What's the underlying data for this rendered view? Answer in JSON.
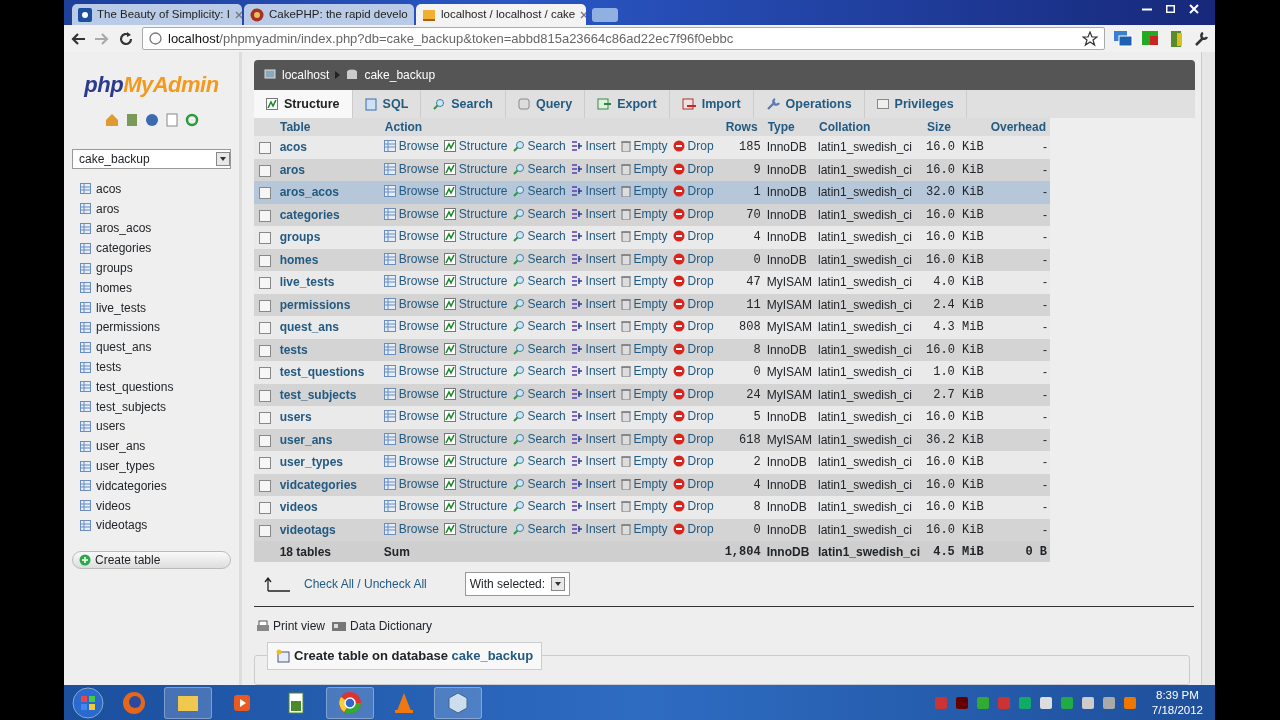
{
  "browser": {
    "tabs": [
      {
        "title": "The Beauty of Simplicity: I",
        "selected": false
      },
      {
        "title": "CakePHP: the rapid develo",
        "selected": false
      },
      {
        "title": "localhost / localhost / cake",
        "selected": true
      }
    ],
    "url_host": "localhost",
    "url_path": "/phpmyadmin/index.php?db=cake_backup&token=abbd815a23664c86ad22ec7f96f0ebbc"
  },
  "sidebar": {
    "logo": [
      "php",
      "MyAdmin"
    ],
    "database": "cake_backup",
    "tables": [
      "acos",
      "aros",
      "aros_acos",
      "categories",
      "groups",
      "homes",
      "live_tests",
      "permissions",
      "quest_ans",
      "tests",
      "test_questions",
      "test_subjects",
      "users",
      "user_ans",
      "user_types",
      "vidcategories",
      "videos",
      "videotags"
    ],
    "create_table": "Create table"
  },
  "breadcrumb": [
    "localhost",
    "cake_backup"
  ],
  "tabs": [
    {
      "label": "Structure",
      "selected": true
    },
    {
      "label": "SQL",
      "selected": false
    },
    {
      "label": "Search",
      "selected": false
    },
    {
      "label": "Query",
      "selected": false
    },
    {
      "label": "Export",
      "selected": false
    },
    {
      "label": "Import",
      "selected": false
    },
    {
      "label": "Operations",
      "selected": false
    },
    {
      "label": "Privileges",
      "selected": false
    }
  ],
  "table": {
    "columns": [
      "Table",
      "Action",
      "Rows",
      "Type",
      "Collation",
      "Size",
      "Overhead"
    ],
    "rows": [
      {
        "name": "acos",
        "actions": [
          "Browse",
          "Structure",
          "Search",
          "Insert",
          "Empty",
          "Drop"
        ],
        "rows": "185",
        "type": "InnoDB",
        "collation": "latin1_swedish_ci",
        "size": "16.0 KiB",
        "overhead": "-",
        "highlighted": false
      },
      {
        "name": "aros",
        "actions": [
          "Browse",
          "Structure",
          "Search",
          "Insert",
          "Empty",
          "Drop"
        ],
        "rows": "9",
        "type": "InnoDB",
        "collation": "latin1_swedish_ci",
        "size": "16.0 KiB",
        "overhead": "-",
        "highlighted": false
      },
      {
        "name": "aros_acos",
        "actions": [
          "Browse",
          "Structure",
          "Search",
          "Insert",
          "Empty",
          "Drop"
        ],
        "rows": "1",
        "type": "InnoDB",
        "collation": "latin1_swedish_ci",
        "size": "32.0 KiB",
        "overhead": "-",
        "highlighted": true
      },
      {
        "name": "categories",
        "actions": [
          "Browse",
          "Structure",
          "Search",
          "Insert",
          "Empty",
          "Drop"
        ],
        "rows": "70",
        "type": "InnoDB",
        "collation": "latin1_swedish_ci",
        "size": "16.0 KiB",
        "overhead": "-",
        "highlighted": false
      },
      {
        "name": "groups",
        "actions": [
          "Browse",
          "Structure",
          "Search",
          "Insert",
          "Empty",
          "Drop"
        ],
        "rows": "4",
        "type": "InnoDB",
        "collation": "latin1_swedish_ci",
        "size": "16.0 KiB",
        "overhead": "-",
        "highlighted": false
      },
      {
        "name": "homes",
        "actions": [
          "Browse",
          "Structure",
          "Search",
          "Insert",
          "Empty",
          "Drop"
        ],
        "rows": "0",
        "type": "InnoDB",
        "collation": "latin1_swedish_ci",
        "size": "16.0 KiB",
        "overhead": "-",
        "highlighted": false
      },
      {
        "name": "live_tests",
        "actions": [
          "Browse",
          "Structure",
          "Search",
          "Insert",
          "Empty",
          "Drop"
        ],
        "rows": "47",
        "type": "MyISAM",
        "collation": "latin1_swedish_ci",
        "size": "4.0 KiB",
        "overhead": "-",
        "highlighted": false
      },
      {
        "name": "permissions",
        "actions": [
          "Browse",
          "Structure",
          "Search",
          "Insert",
          "Empty",
          "Drop"
        ],
        "rows": "11",
        "type": "MyISAM",
        "collation": "latin1_swedish_ci",
        "size": "2.4 KiB",
        "overhead": "-",
        "highlighted": false
      },
      {
        "name": "quest_ans",
        "actions": [
          "Browse",
          "Structure",
          "Search",
          "Insert",
          "Empty",
          "Drop"
        ],
        "rows": "808",
        "type": "MyISAM",
        "collation": "latin1_swedish_ci",
        "size": "4.3 MiB",
        "overhead": "-",
        "highlighted": false
      },
      {
        "name": "tests",
        "actions": [
          "Browse",
          "Structure",
          "Search",
          "Insert",
          "Empty",
          "Drop"
        ],
        "rows": "8",
        "type": "InnoDB",
        "collation": "latin1_swedish_ci",
        "size": "16.0 KiB",
        "overhead": "-",
        "highlighted": false
      },
      {
        "name": "test_questions",
        "actions": [
          "Browse",
          "Structure",
          "Search",
          "Insert",
          "Empty",
          "Drop"
        ],
        "rows": "0",
        "type": "MyISAM",
        "collation": "latin1_swedish_ci",
        "size": "1.0 KiB",
        "overhead": "-",
        "highlighted": false
      },
      {
        "name": "test_subjects",
        "actions": [
          "Browse",
          "Structure",
          "Search",
          "Insert",
          "Empty",
          "Drop"
        ],
        "rows": "24",
        "type": "MyISAM",
        "collation": "latin1_swedish_ci",
        "size": "2.7 KiB",
        "overhead": "-",
        "highlighted": false
      },
      {
        "name": "users",
        "actions": [
          "Browse",
          "Structure",
          "Search",
          "Insert",
          "Empty",
          "Drop"
        ],
        "rows": "5",
        "type": "InnoDB",
        "collation": "latin1_swedish_ci",
        "size": "16.0 KiB",
        "overhead": "-",
        "highlighted": false
      },
      {
        "name": "user_ans",
        "actions": [
          "Browse",
          "Structure",
          "Search",
          "Insert",
          "Empty",
          "Drop"
        ],
        "rows": "618",
        "type": "MyISAM",
        "collation": "latin1_swedish_ci",
        "size": "36.2 KiB",
        "overhead": "-",
        "highlighted": false
      },
      {
        "name": "user_types",
        "actions": [
          "Browse",
          "Structure",
          "Search",
          "Insert",
          "Empty",
          "Drop"
        ],
        "rows": "2",
        "type": "InnoDB",
        "collation": "latin1_swedish_ci",
        "size": "16.0 KiB",
        "overhead": "-",
        "highlighted": false
      },
      {
        "name": "vidcategories",
        "actions": [
          "Browse",
          "Structure",
          "Search",
          "Insert",
          "Empty",
          "Drop"
        ],
        "rows": "4",
        "type": "InnoDB",
        "collation": "latin1_swedish_ci",
        "size": "16.0 KiB",
        "overhead": "-",
        "highlighted": false
      },
      {
        "name": "videos",
        "actions": [
          "Browse",
          "Structure",
          "Search",
          "Insert",
          "Empty",
          "Drop"
        ],
        "rows": "8",
        "type": "InnoDB",
        "collation": "latin1_swedish_ci",
        "size": "16.0 KiB",
        "overhead": "-",
        "highlighted": false
      },
      {
        "name": "videotags",
        "actions": [
          "Browse",
          "Structure",
          "Search",
          "Insert",
          "Empty",
          "Drop"
        ],
        "rows": "0",
        "type": "InnoDB",
        "collation": "latin1_swedish_ci",
        "size": "16.0 KiB",
        "overhead": "-",
        "highlighted": false
      }
    ],
    "footer": {
      "count": "18 tables",
      "label": "Sum",
      "rows": "1,804",
      "type": "InnoDB",
      "collation": "latin1_swedish_ci",
      "size": "4.5 MiB",
      "overhead": "0 B"
    }
  },
  "check_all": "Check All / Uncheck All",
  "with_selected": "With selected:",
  "links": [
    "Print view",
    "Data Dictionary"
  ],
  "create_legend": {
    "text": "Create table on database",
    "database": "cake_backup"
  },
  "clock": {
    "time": "8:39 PM",
    "date": "7/18/2012"
  }
}
